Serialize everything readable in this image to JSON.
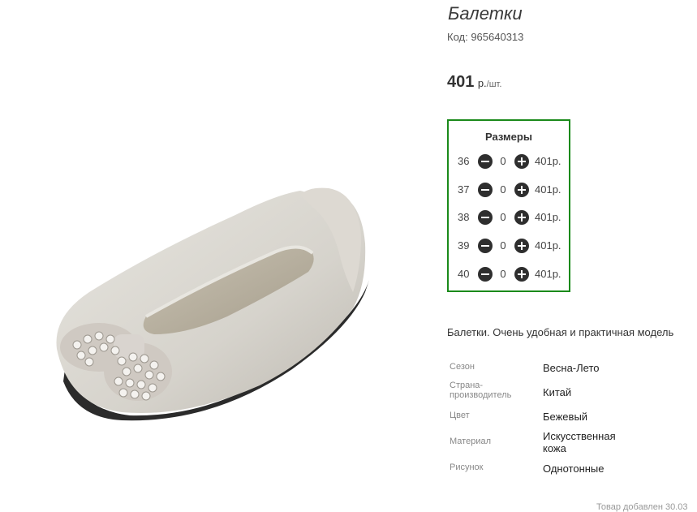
{
  "product": {
    "title": "Балетки",
    "code": "Код: 965640313",
    "price_value": "401",
    "price_currency": "р.",
    "price_per": "/шт.",
    "image_alt": "beige-ballet-flat-with-pearl-bow"
  },
  "sizes": {
    "title": "Размеры",
    "rows": [
      {
        "size": "36",
        "qty": "0",
        "sum": "401р."
      },
      {
        "size": "37",
        "qty": "0",
        "sum": "401р."
      },
      {
        "size": "38",
        "qty": "0",
        "sum": "401р."
      },
      {
        "size": "39",
        "qty": "0",
        "sum": "401р."
      },
      {
        "size": "40",
        "qty": "0",
        "sum": "401р."
      }
    ]
  },
  "description": "Балетки. Очень удобная и практичная модель",
  "properties": [
    {
      "key": "Сезон",
      "value": "Весна-Лето"
    },
    {
      "key": "Страна-\nпроизводитель",
      "value": "Китай"
    },
    {
      "key": "Цвет",
      "value": "Бежевый"
    },
    {
      "key": "Материал",
      "value": "Искусственная\nкожа"
    },
    {
      "key": "Рисунок",
      "value": "Однотонные"
    }
  ],
  "added_text": "Товар добавлен 30.03",
  "colors": {
    "box_border": "#1a8a1a",
    "icon": "#2e2e2e"
  }
}
